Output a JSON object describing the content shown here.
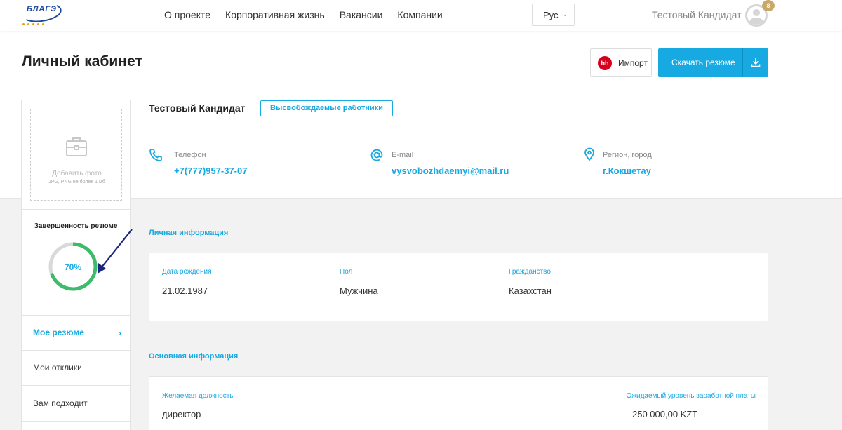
{
  "header": {
    "logo_text": "БЛАГЭ",
    "nav": [
      "О проекте",
      "Корпоративная жизнь",
      "Вакансии",
      "Компании"
    ],
    "language": "Рус",
    "user_name": "Тестовый Кандидат",
    "notifications": "8"
  },
  "page": {
    "title": "Личный кабинет",
    "import_label": "Импорт",
    "hh_label": "hh",
    "download_label": "Скачать резюме"
  },
  "sidebar": {
    "photo_title": "Добавить фото",
    "photo_hint": "JPG, PNG не более 1 мб",
    "completeness_label": "Завершенность резюме",
    "completeness_value": "70%",
    "completeness_fraction": 0.7,
    "items": [
      {
        "label": "Мое резюме",
        "active": true
      },
      {
        "label": "Мои отклики",
        "active": false
      },
      {
        "label": "Вам подходит",
        "active": false
      }
    ]
  },
  "candidate": {
    "name": "Тестовый Кандидат",
    "tag": "Высвобождаемые работники",
    "contacts": [
      {
        "label": "Телефон",
        "value": "+7(777)957-37-07",
        "icon": "phone-icon"
      },
      {
        "label": "E-mail",
        "value": "vysvobozhdaemyi@mail.ru",
        "icon": "at-icon"
      },
      {
        "label": "Регион, город",
        "value": "г.Кокшетау",
        "icon": "location-icon"
      }
    ]
  },
  "personal": {
    "title": "Личная информация",
    "fields": [
      {
        "label": "Дата рождения",
        "value": "21.02.1987"
      },
      {
        "label": "Пол",
        "value": "Мужчина"
      },
      {
        "label": "Гражданство",
        "value": "Казахстан"
      }
    ]
  },
  "basic": {
    "title": "Основная информация",
    "position_label": "Желаемая должность",
    "position_value": "директор",
    "salary_label": "Ожидаемый уровень заработной платы",
    "salary_value": "250 000,00 KZT"
  },
  "colors": {
    "accent": "#17a9e1",
    "progress": "#3dbb6b",
    "hh": "#d6001c",
    "badge": "#c9a86a"
  }
}
